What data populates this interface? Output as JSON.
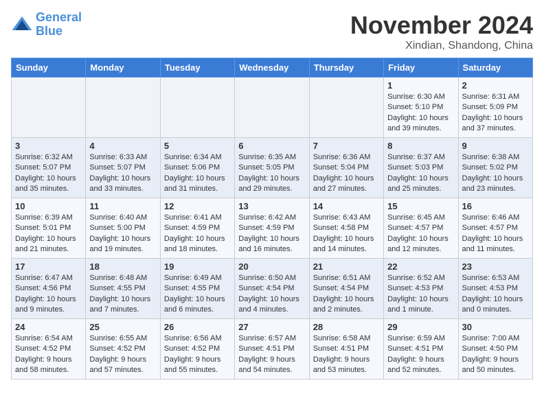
{
  "logo": {
    "line1": "General",
    "line2": "Blue"
  },
  "title": "November 2024",
  "subtitle": "Xindian, Shandong, China",
  "headers": [
    "Sunday",
    "Monday",
    "Tuesday",
    "Wednesday",
    "Thursday",
    "Friday",
    "Saturday"
  ],
  "weeks": [
    [
      {
        "day": "",
        "info": ""
      },
      {
        "day": "",
        "info": ""
      },
      {
        "day": "",
        "info": ""
      },
      {
        "day": "",
        "info": ""
      },
      {
        "day": "",
        "info": ""
      },
      {
        "day": "1",
        "info": "Sunrise: 6:30 AM\nSunset: 5:10 PM\nDaylight: 10 hours\nand 39 minutes."
      },
      {
        "day": "2",
        "info": "Sunrise: 6:31 AM\nSunset: 5:09 PM\nDaylight: 10 hours\nand 37 minutes."
      }
    ],
    [
      {
        "day": "3",
        "info": "Sunrise: 6:32 AM\nSunset: 5:07 PM\nDaylight: 10 hours\nand 35 minutes."
      },
      {
        "day": "4",
        "info": "Sunrise: 6:33 AM\nSunset: 5:07 PM\nDaylight: 10 hours\nand 33 minutes."
      },
      {
        "day": "5",
        "info": "Sunrise: 6:34 AM\nSunset: 5:06 PM\nDaylight: 10 hours\nand 31 minutes."
      },
      {
        "day": "6",
        "info": "Sunrise: 6:35 AM\nSunset: 5:05 PM\nDaylight: 10 hours\nand 29 minutes."
      },
      {
        "day": "7",
        "info": "Sunrise: 6:36 AM\nSunset: 5:04 PM\nDaylight: 10 hours\nand 27 minutes."
      },
      {
        "day": "8",
        "info": "Sunrise: 6:37 AM\nSunset: 5:03 PM\nDaylight: 10 hours\nand 25 minutes."
      },
      {
        "day": "9",
        "info": "Sunrise: 6:38 AM\nSunset: 5:02 PM\nDaylight: 10 hours\nand 23 minutes."
      }
    ],
    [
      {
        "day": "10",
        "info": "Sunrise: 6:39 AM\nSunset: 5:01 PM\nDaylight: 10 hours\nand 21 minutes."
      },
      {
        "day": "11",
        "info": "Sunrise: 6:40 AM\nSunset: 5:00 PM\nDaylight: 10 hours\nand 19 minutes."
      },
      {
        "day": "12",
        "info": "Sunrise: 6:41 AM\nSunset: 4:59 PM\nDaylight: 10 hours\nand 18 minutes."
      },
      {
        "day": "13",
        "info": "Sunrise: 6:42 AM\nSunset: 4:59 PM\nDaylight: 10 hours\nand 16 minutes."
      },
      {
        "day": "14",
        "info": "Sunrise: 6:43 AM\nSunset: 4:58 PM\nDaylight: 10 hours\nand 14 minutes."
      },
      {
        "day": "15",
        "info": "Sunrise: 6:45 AM\nSunset: 4:57 PM\nDaylight: 10 hours\nand 12 minutes."
      },
      {
        "day": "16",
        "info": "Sunrise: 6:46 AM\nSunset: 4:57 PM\nDaylight: 10 hours\nand 11 minutes."
      }
    ],
    [
      {
        "day": "17",
        "info": "Sunrise: 6:47 AM\nSunset: 4:56 PM\nDaylight: 10 hours\nand 9 minutes."
      },
      {
        "day": "18",
        "info": "Sunrise: 6:48 AM\nSunset: 4:55 PM\nDaylight: 10 hours\nand 7 minutes."
      },
      {
        "day": "19",
        "info": "Sunrise: 6:49 AM\nSunset: 4:55 PM\nDaylight: 10 hours\nand 6 minutes."
      },
      {
        "day": "20",
        "info": "Sunrise: 6:50 AM\nSunset: 4:54 PM\nDaylight: 10 hours\nand 4 minutes."
      },
      {
        "day": "21",
        "info": "Sunrise: 6:51 AM\nSunset: 4:54 PM\nDaylight: 10 hours\nand 2 minutes."
      },
      {
        "day": "22",
        "info": "Sunrise: 6:52 AM\nSunset: 4:53 PM\nDaylight: 10 hours\nand 1 minute."
      },
      {
        "day": "23",
        "info": "Sunrise: 6:53 AM\nSunset: 4:53 PM\nDaylight: 10 hours\nand 0 minutes."
      }
    ],
    [
      {
        "day": "24",
        "info": "Sunrise: 6:54 AM\nSunset: 4:52 PM\nDaylight: 9 hours\nand 58 minutes."
      },
      {
        "day": "25",
        "info": "Sunrise: 6:55 AM\nSunset: 4:52 PM\nDaylight: 9 hours\nand 57 minutes."
      },
      {
        "day": "26",
        "info": "Sunrise: 6:56 AM\nSunset: 4:52 PM\nDaylight: 9 hours\nand 55 minutes."
      },
      {
        "day": "27",
        "info": "Sunrise: 6:57 AM\nSunset: 4:51 PM\nDaylight: 9 hours\nand 54 minutes."
      },
      {
        "day": "28",
        "info": "Sunrise: 6:58 AM\nSunset: 4:51 PM\nDaylight: 9 hours\nand 53 minutes."
      },
      {
        "day": "29",
        "info": "Sunrise: 6:59 AM\nSunset: 4:51 PM\nDaylight: 9 hours\nand 52 minutes."
      },
      {
        "day": "30",
        "info": "Sunrise: 7:00 AM\nSunset: 4:50 PM\nDaylight: 9 hours\nand 50 minutes."
      }
    ]
  ]
}
